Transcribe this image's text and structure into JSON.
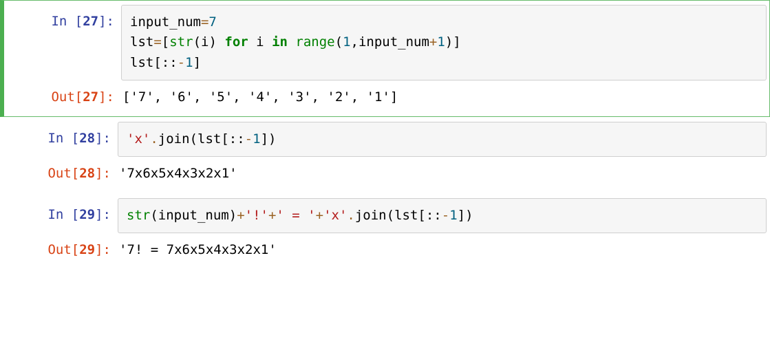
{
  "cells": [
    {
      "selected": true,
      "in_label": "In [",
      "in_num": "27",
      "in_close": "]:",
      "out_label": "Out[",
      "out_num": "27",
      "out_close": "]:",
      "code_tokens": [
        {
          "cls": "t-var",
          "t": "input_num"
        },
        {
          "cls": "t-op",
          "t": "="
        },
        {
          "cls": "t-num",
          "t": "7"
        },
        {
          "cls": "",
          "t": "\n"
        },
        {
          "cls": "t-var",
          "t": "lst"
        },
        {
          "cls": "t-op",
          "t": "="
        },
        {
          "cls": "t-punc",
          "t": "["
        },
        {
          "cls": "t-builtin",
          "t": "str"
        },
        {
          "cls": "t-punc",
          "t": "("
        },
        {
          "cls": "t-var",
          "t": "i"
        },
        {
          "cls": "t-punc",
          "t": ")"
        },
        {
          "cls": "",
          "t": " "
        },
        {
          "cls": "t-kw",
          "t": "for"
        },
        {
          "cls": "",
          "t": " "
        },
        {
          "cls": "t-var",
          "t": "i"
        },
        {
          "cls": "",
          "t": " "
        },
        {
          "cls": "t-kw",
          "t": "in"
        },
        {
          "cls": "",
          "t": " "
        },
        {
          "cls": "t-builtin",
          "t": "range"
        },
        {
          "cls": "t-punc",
          "t": "("
        },
        {
          "cls": "t-num",
          "t": "1"
        },
        {
          "cls": "t-punc",
          "t": ","
        },
        {
          "cls": "t-var",
          "t": "input_num"
        },
        {
          "cls": "t-op",
          "t": "+"
        },
        {
          "cls": "t-num",
          "t": "1"
        },
        {
          "cls": "t-punc",
          "t": ")"
        },
        {
          "cls": "t-punc",
          "t": "]"
        },
        {
          "cls": "",
          "t": "\n"
        },
        {
          "cls": "t-var",
          "t": "lst"
        },
        {
          "cls": "t-punc",
          "t": "[::"
        },
        {
          "cls": "t-op",
          "t": "-"
        },
        {
          "cls": "t-num",
          "t": "1"
        },
        {
          "cls": "t-punc",
          "t": "]"
        }
      ],
      "output": "['7', '6', '5', '4', '3', '2', '1']"
    },
    {
      "selected": false,
      "in_label": "In [",
      "in_num": "28",
      "in_close": "]:",
      "out_label": "Out[",
      "out_num": "28",
      "out_close": "]:",
      "code_tokens": [
        {
          "cls": "t-str",
          "t": "'x'"
        },
        {
          "cls": "t-op",
          "t": "."
        },
        {
          "cls": "t-var",
          "t": "join"
        },
        {
          "cls": "t-punc",
          "t": "("
        },
        {
          "cls": "t-var",
          "t": "lst"
        },
        {
          "cls": "t-punc",
          "t": "[::"
        },
        {
          "cls": "t-op",
          "t": "-"
        },
        {
          "cls": "t-num",
          "t": "1"
        },
        {
          "cls": "t-punc",
          "t": "]"
        },
        {
          "cls": "t-punc",
          "t": ")"
        }
      ],
      "output": "'7x6x5x4x3x2x1'"
    },
    {
      "selected": false,
      "in_label": "In [",
      "in_num": "29",
      "in_close": "]:",
      "out_label": "Out[",
      "out_num": "29",
      "out_close": "]:",
      "code_tokens": [
        {
          "cls": "t-builtin",
          "t": "str"
        },
        {
          "cls": "t-punc",
          "t": "("
        },
        {
          "cls": "t-var",
          "t": "input_num"
        },
        {
          "cls": "t-punc",
          "t": ")"
        },
        {
          "cls": "t-op",
          "t": "+"
        },
        {
          "cls": "t-str",
          "t": "'!'"
        },
        {
          "cls": "t-op",
          "t": "+"
        },
        {
          "cls": "t-str",
          "t": "' = '"
        },
        {
          "cls": "t-op",
          "t": "+"
        },
        {
          "cls": "t-str",
          "t": "'x'"
        },
        {
          "cls": "t-op",
          "t": "."
        },
        {
          "cls": "t-var",
          "t": "join"
        },
        {
          "cls": "t-punc",
          "t": "("
        },
        {
          "cls": "t-var",
          "t": "lst"
        },
        {
          "cls": "t-punc",
          "t": "[::"
        },
        {
          "cls": "t-op",
          "t": "-"
        },
        {
          "cls": "t-num",
          "t": "1"
        },
        {
          "cls": "t-punc",
          "t": "]"
        },
        {
          "cls": "t-punc",
          "t": ")"
        }
      ],
      "output": "'7! = 7x6x5x4x3x2x1'"
    }
  ]
}
